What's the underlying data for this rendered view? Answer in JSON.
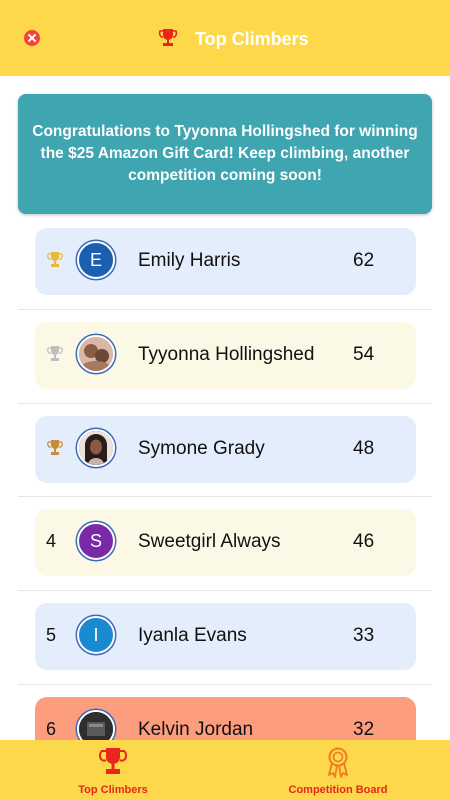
{
  "header": {
    "title": "Top Climbers",
    "close_icon": "close-icon",
    "trophy_icon": "trophy-icon"
  },
  "banner": {
    "message": "Congratulations to Tyyonna Hollingshed for winning the $25 Amazon Gift Card! Keep climbing, another competition coming soon!"
  },
  "leaderboard": [
    {
      "rank": "1",
      "rank_icon": "gold-trophy-icon",
      "avatar_letter": "E",
      "avatar_color": "#1b5fb0",
      "name": "Emily Harris",
      "score": "62",
      "row_color": "#e4edfb"
    },
    {
      "rank": "2",
      "rank_icon": "silver-trophy-icon",
      "avatar_letter": "",
      "avatar_color": "#c9a38c",
      "name": "Tyyonna Hollingshed",
      "score": "54",
      "row_color": "#fcf8e6"
    },
    {
      "rank": "3",
      "rank_icon": "bronze-trophy-icon",
      "avatar_letter": "",
      "avatar_color": "#6b4a3e",
      "name": "Symone Grady",
      "score": "48",
      "row_color": "#e4edfb"
    },
    {
      "rank": "4",
      "rank_icon": "",
      "avatar_letter": "S",
      "avatar_color": "#7a2aa8",
      "name": "Sweetgirl Always",
      "score": "46",
      "row_color": "#fcf8e6"
    },
    {
      "rank": "5",
      "rank_icon": "",
      "avatar_letter": "I",
      "avatar_color": "#1a8ad0",
      "name": "Iyanla Evans",
      "score": "33",
      "row_color": "#e4edfb"
    },
    {
      "rank": "6",
      "rank_icon": "",
      "avatar_letter": "",
      "avatar_color": "#3a3a3a",
      "name": "Kelvin Jordan",
      "score": "32",
      "row_color": "#fc9e7e"
    }
  ],
  "tabs": [
    {
      "label": "Top Climbers",
      "icon": "trophy-icon",
      "active": true,
      "color": "#e8261c"
    },
    {
      "label": "Competition Board",
      "icon": "award-ribbon-icon",
      "active": false,
      "color": "#f07a22"
    }
  ],
  "colors": {
    "header_bg": "#fdd84a",
    "banner_bg": "#3fa5b1",
    "gold": "#e8b93a",
    "silver": "#bfbfbf",
    "bronze": "#c98a3a"
  }
}
